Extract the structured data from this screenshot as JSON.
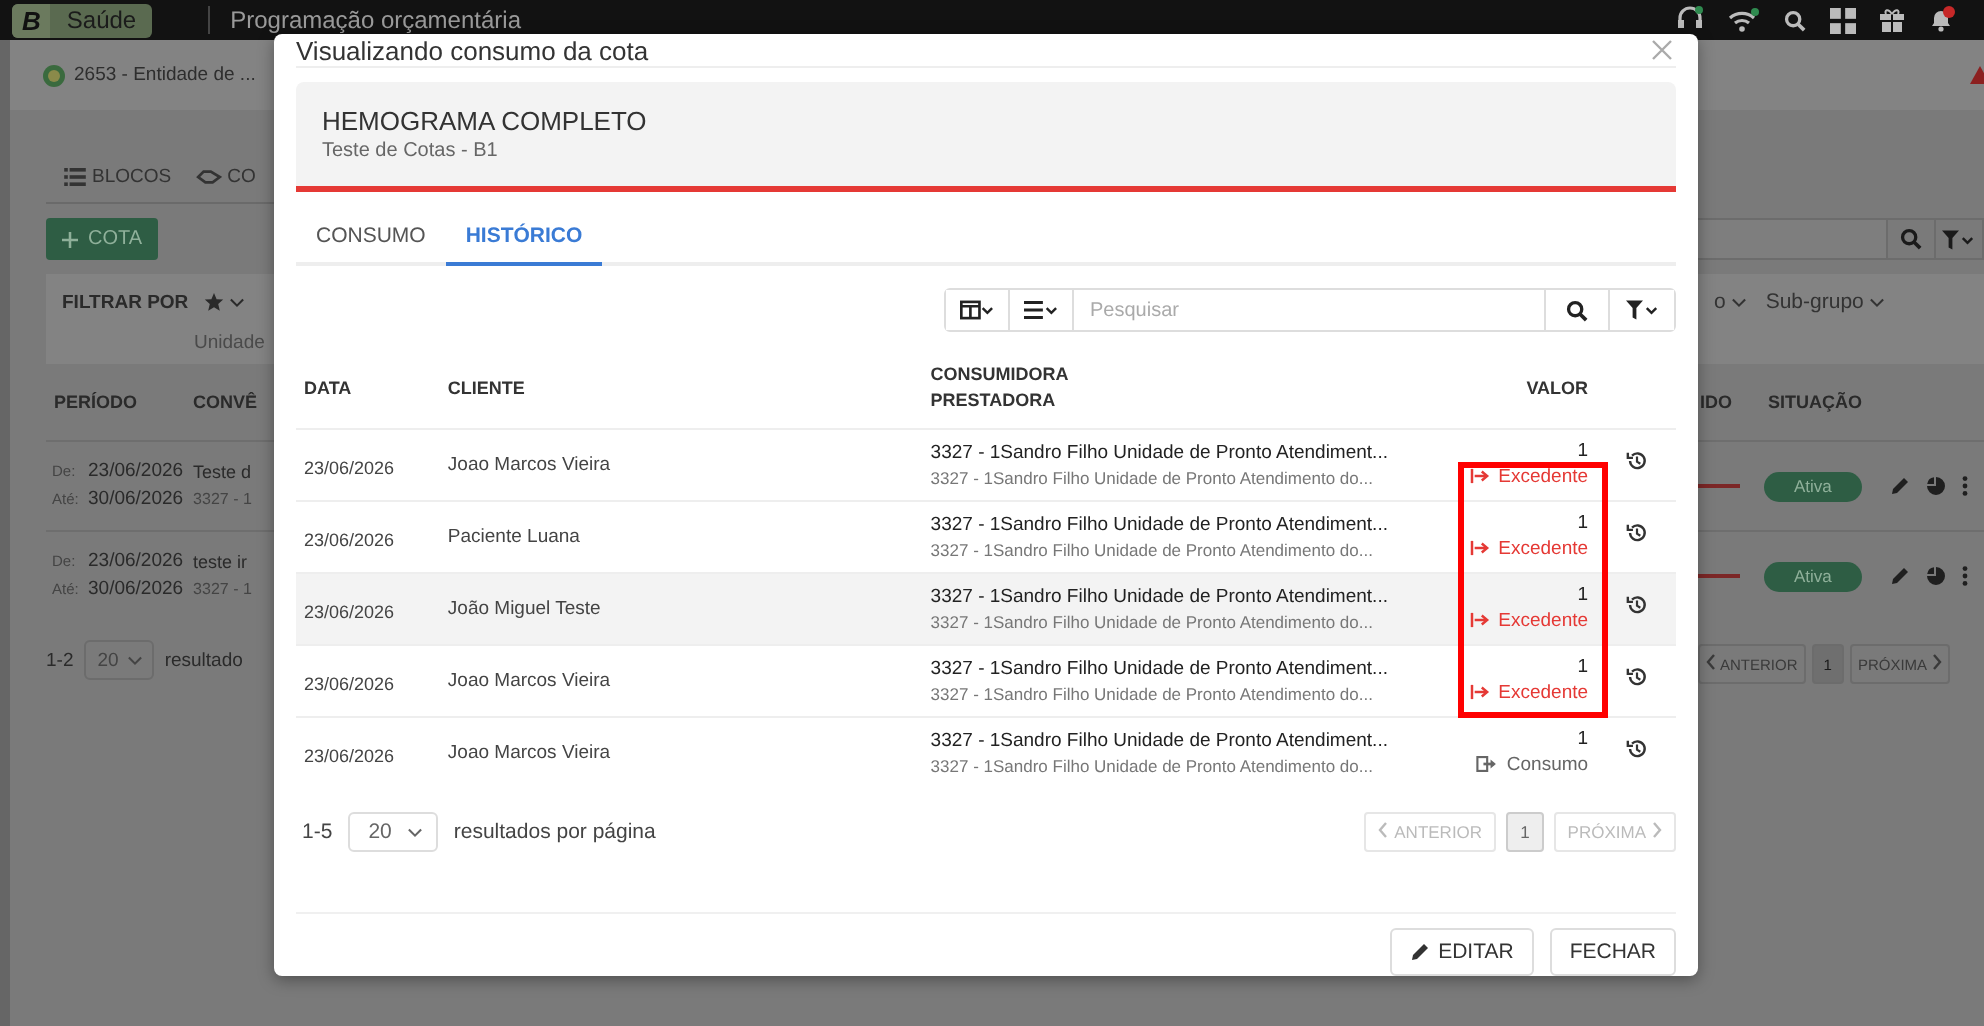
{
  "top_bar": {
    "logo": "B",
    "module": "Saúde",
    "title": "Programação orçamentária"
  },
  "page": {
    "entity": "2653 - Entidade de ...",
    "tabs": [
      {
        "label": "BLOCOS"
      },
      {
        "label": "CO"
      }
    ],
    "add_button": "COTA",
    "filter_label": "FILTRAR POR",
    "filter_field": "Unidade",
    "right_filters": [
      "o",
      "Sub-grupo"
    ],
    "columns_left": [
      "PERÍODO",
      "CONVÊ"
    ],
    "columns_right": [
      "IDO",
      "SITUAÇÃO"
    ],
    "rows": [
      {
        "from_label": "De:",
        "from": "23/06/2026",
        "to_label": "Até:",
        "to": "30/06/2026",
        "name": "Teste d",
        "code": "3327 - 1",
        "status": "Ativa"
      },
      {
        "from_label": "De:",
        "from": "23/06/2026",
        "to_label": "Até:",
        "to": "30/06/2026",
        "name": "teste ir",
        "code": "3327 - 1",
        "status": "Ativa"
      }
    ],
    "pagination": {
      "range": "1-2",
      "page_size": "20",
      "per_page": "resultado",
      "prev": {
        "label": "ANTERIOR",
        "disabled": true
      },
      "page": "1",
      "next": {
        "label": "PRÓXIMA",
        "disabled": true
      }
    }
  },
  "modal": {
    "title": "Visualizando consumo da cota",
    "item": {
      "name": "HEMOGRAMA COMPLETO",
      "subtitle": "Teste de Cotas - B1"
    },
    "tabs": [
      {
        "label": "CONSUMO",
        "selected": false
      },
      {
        "label": "HISTÓRICO",
        "selected": true
      }
    ],
    "search": {
      "placeholder": "Pesquisar"
    },
    "columns": [
      {
        "lines": [
          "DATA"
        ]
      },
      {
        "lines": [
          "CLIENTE"
        ]
      },
      {
        "lines": [
          "CONSUMIDORA",
          "PRESTADORA"
        ]
      },
      {
        "lines": [
          "VALOR"
        ]
      }
    ],
    "rows": [
      {
        "date": "23/06/2026",
        "client": "Joao Marcos Vieira",
        "consumer": "3327 - 1Sandro Filho Unidade de Pronto Atendiment...",
        "provider": "3327 - 1Sandro Filho Unidade de Pronto Atendimento do...",
        "value": "1",
        "kind": "excedente",
        "type_label": "Excedente",
        "hovered": false,
        "marked": true
      },
      {
        "date": "23/06/2026",
        "client": "Paciente Luana",
        "consumer": "3327 - 1Sandro Filho Unidade de Pronto Atendiment...",
        "provider": "3327 - 1Sandro Filho Unidade de Pronto Atendimento do...",
        "value": "1",
        "kind": "excedente",
        "type_label": "Excedente",
        "hovered": false,
        "marked": true
      },
      {
        "date": "23/06/2026",
        "client": "João Miguel Teste",
        "consumer": "3327 - 1Sandro Filho Unidade de Pronto Atendiment...",
        "provider": "3327 - 1Sandro Filho Unidade de Pronto Atendimento do...",
        "value": "1",
        "kind": "excedente",
        "type_label": "Excedente",
        "hovered": true,
        "marked": true
      },
      {
        "date": "23/06/2026",
        "client": "Joao Marcos Vieira",
        "consumer": "3327 - 1Sandro Filho Unidade de Pronto Atendiment...",
        "provider": "3327 - 1Sandro Filho Unidade de Pronto Atendimento do...",
        "value": "1",
        "kind": "excedente",
        "type_label": "Excedente",
        "hovered": false,
        "marked": true
      },
      {
        "date": "23/06/2026",
        "client": "Joao Marcos Vieira",
        "consumer": "3327 - 1Sandro Filho Unidade de Pronto Atendiment...",
        "provider": "3327 - 1Sandro Filho Unidade de Pronto Atendimento do...",
        "value": "1",
        "kind": "consumo",
        "type_label": "Consumo",
        "hovered": false,
        "marked": false
      }
    ],
    "pagination": {
      "range": "1-5",
      "page_size": "20",
      "per_page": "resultados por página",
      "prev": {
        "label": "ANTERIOR",
        "disabled": true
      },
      "page": "1",
      "next": {
        "label": "PRÓXIMA",
        "disabled": true
      }
    },
    "buttons": [
      {
        "kind": "edit",
        "label": "EDITAR"
      },
      {
        "kind": "close",
        "label": "FECHAR"
      }
    ]
  }
}
